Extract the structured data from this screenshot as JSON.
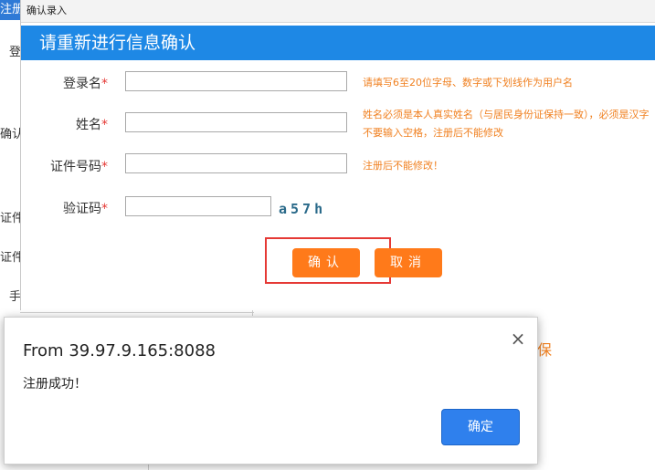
{
  "background": {
    "tab_label": "注册",
    "label_1": "登",
    "label_2": "确认",
    "label_3": "证件",
    "label_4": "证件",
    "label_5": "手",
    "label_6": "保"
  },
  "dialog": {
    "window_title": "确认录入",
    "banner_title": "请重新进行信息确认",
    "fields": [
      {
        "label": "登录名",
        "required_mark": "*",
        "value": "",
        "hint": "请填写6至20位字母、数字或下划线作为用户名"
      },
      {
        "label": "姓名",
        "required_mark": "*",
        "value": "",
        "hint": "姓名必须是本人真实姓名（与居民身份证保持一致），必须是汉字",
        "hint2": "不要输入空格，注册后不能修改"
      },
      {
        "label": "证件号码",
        "required_mark": "*",
        "value": "",
        "hint": "注册后不能修改！"
      },
      {
        "label": "验证码",
        "required_mark": "*",
        "value": "",
        "captcha": "a57h"
      }
    ],
    "confirm_label": "确认",
    "cancel_label": "取消"
  },
  "alert": {
    "title": "From 39.97.9.165:8088",
    "message": "注册成功！",
    "ok_label": "确定",
    "close_icon": "×"
  },
  "colors": {
    "banner": "#1e88e5",
    "button": "#ff7a1a",
    "highlight": "#e53935",
    "hint": "#f08020",
    "alert_ok": "#2f80ed"
  }
}
